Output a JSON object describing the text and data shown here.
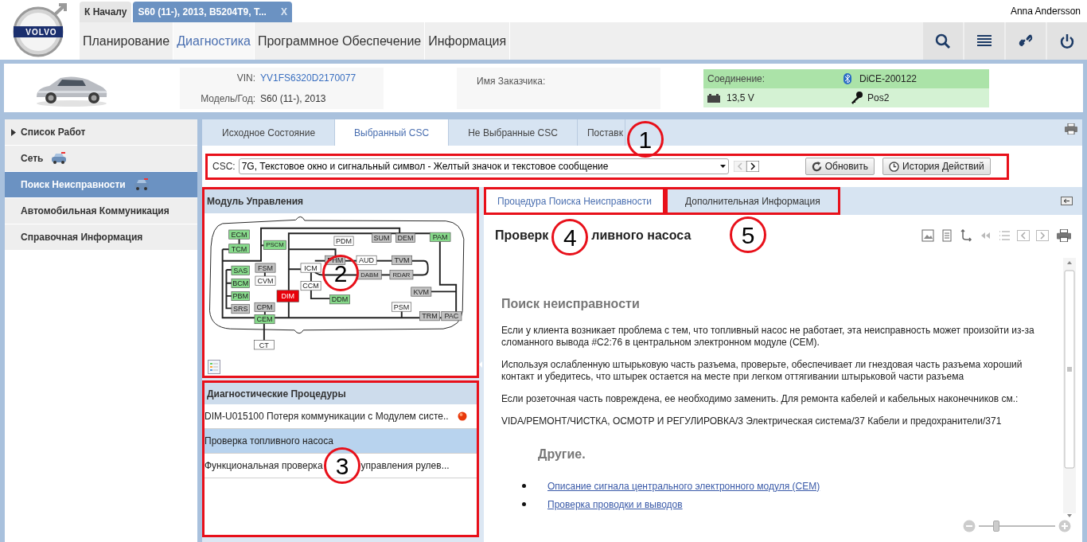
{
  "header": {
    "logo_text": "VOLVO",
    "user": "Anna Andersson",
    "tabs": [
      {
        "label": "К Началу",
        "selected": false
      },
      {
        "label": "S60 (11-), 2013, B5204T9, T...",
        "selected": true,
        "close": "X"
      }
    ],
    "nav": [
      {
        "label": "Планирование",
        "selected": false
      },
      {
        "label": "Диагностика",
        "selected": true
      },
      {
        "label": "Программное Обеспечение",
        "selected": false
      },
      {
        "label": "Информация",
        "selected": false
      }
    ]
  },
  "vehicle": {
    "vin_label": "VIN:",
    "vin": "YV1FS6320D2170077",
    "model_label": "Модель/Год:",
    "model": "S60 (11-), 2013",
    "customer_label": "Имя Заказчика:",
    "connection_label": "Соединение:",
    "device": "DiCE-200122",
    "voltage": "13,5 V",
    "key_position": "Pos2"
  },
  "sidebar": {
    "items": [
      {
        "label": "Список Работ",
        "kind": "group",
        "selected": false
      },
      {
        "label": "Сеть",
        "kind": "icon",
        "selected": false
      },
      {
        "label": "Поиск Неисправности",
        "kind": "icon",
        "selected": true
      },
      {
        "label": "Автомобильная Коммуникация",
        "kind": "plain",
        "selected": false
      },
      {
        "label": "Справочная Информация",
        "kind": "plain",
        "selected": false
      }
    ]
  },
  "main_tabs": [
    {
      "label": "Исходное Состояние",
      "selected": false
    },
    {
      "label": "Выбранный CSC",
      "selected": true
    },
    {
      "label": "Не Выбранные CSC",
      "selected": false
    },
    {
      "label": "Поставк",
      "selected": false,
      "callout": "1"
    }
  ],
  "csc": {
    "label": "CSC:",
    "value": "7G, Текстовое окно и сигнальный символ - Желтый значок и текстовое сообщение",
    "highlighted": true,
    "buttons": [
      {
        "label": "Обновить",
        "kind": "refresh"
      },
      {
        "label": "История Действий",
        "kind": "history"
      }
    ]
  },
  "module_panel": {
    "title": "Модуль Управления",
    "highlighted": true,
    "callout": "2",
    "modules": [
      {
        "label": "ECM",
        "color": "#86d98a"
      },
      {
        "label": "TCM",
        "color": "#86d98a"
      },
      {
        "label": "PSCM",
        "color": "#86d98a"
      },
      {
        "label": "PDM",
        "color": "#ffffff"
      },
      {
        "label": "SUM",
        "color": "#c2c2c2"
      },
      {
        "label": "DEM",
        "color": "#c2c2c2"
      },
      {
        "label": "PAM",
        "color": "#86d98a"
      },
      {
        "label": "PHM",
        "color": "#c2c2c2"
      },
      {
        "label": "AUD",
        "color": "#ffffff"
      },
      {
        "label": "TVM",
        "color": "#c2c2c2"
      },
      {
        "label": "SAS",
        "color": "#86d98a"
      },
      {
        "label": "FSM",
        "color": "#c2c2c2"
      },
      {
        "label": "ICM",
        "color": "#ffffff"
      },
      {
        "label": "DABM",
        "color": "#c2c2c2"
      },
      {
        "label": "RDAR",
        "color": "#c2c2c2"
      },
      {
        "label": "BCM",
        "color": "#86d98a"
      },
      {
        "label": "CVM",
        "color": "#ffffff"
      },
      {
        "label": "CCM",
        "color": "#ffffff"
      },
      {
        "label": "DIM",
        "color": "#e8000a"
      },
      {
        "label": "KVM",
        "color": "#c2c2c2"
      },
      {
        "label": "PBM",
        "color": "#86d98a"
      },
      {
        "label": "DDM",
        "color": "#86d98a"
      },
      {
        "label": "SRS",
        "color": "#c2c2c2"
      },
      {
        "label": "CPM",
        "color": "#c2c2c2"
      },
      {
        "label": "PSM",
        "color": "#ffffff"
      },
      {
        "label": "CEM",
        "color": "#86d98a"
      },
      {
        "label": "TRM",
        "color": "#c2c2c2"
      },
      {
        "label": "PAC",
        "color": "#c2c2c2"
      },
      {
        "label": "CT",
        "color": "#ffffff"
      }
    ]
  },
  "procedures_panel": {
    "title": "Диагностические Процедуры",
    "highlighted": true,
    "rows": [
      {
        "parts": [
          "DIM-U015100 Потеря коммуникации с Модулем систе.."
        ],
        "selected": false,
        "alert": true
      },
      {
        "parts": [
          "Проверка топливного насоса"
        ],
        "selected": true,
        "alert": false
      },
      {
        "parts": [
          "Функциональная проверка",
          "управления рулев..."
        ],
        "selected": false,
        "alert": false,
        "callout": "3"
      }
    ]
  },
  "content_tabs": [
    {
      "label": "Процедура Поиска Неисправности",
      "selected": true,
      "highlighted": true
    },
    {
      "label": "Дополнительная Информация",
      "selected": false,
      "highlighted": true,
      "callout": "5"
    }
  ],
  "article": {
    "heading_parts": [
      "Проверк",
      "ливного насоса"
    ],
    "heading_callout": "4",
    "section_title": "Поиск неисправности",
    "paragraphs": [
      "Если у клиента возникает проблема с тем, что топливный насос не работает, эта неисправность может произойти из-за сломанного вывода #C2:76 в центральном электронном модуле (CEM).",
      "Используя ослабленную штырьковую часть разъема, проверьте, обеспечивает ли гнездовая часть разъема хороший контакт и убедитесь, что штырек остается на месте при легком оттягивании штырьковой части разъема",
      "Если розеточная часть повреждена, ее необходимо заменить. Для ремонта кабелей и кабельных наконечников см.:",
      "VIDA/РЕМОНТ/ЧИСТКА, ОСМОТР И РЕГУЛИРОВКА/3 Электрическая система/37 Кабели и предохранители/371"
    ],
    "subheading": "Другие.",
    "links": [
      "Описание сигнала центрального электронного модуля (CEM)",
      "Проверка проводки и выводов"
    ]
  },
  "zoom": {
    "level": 0.2
  }
}
